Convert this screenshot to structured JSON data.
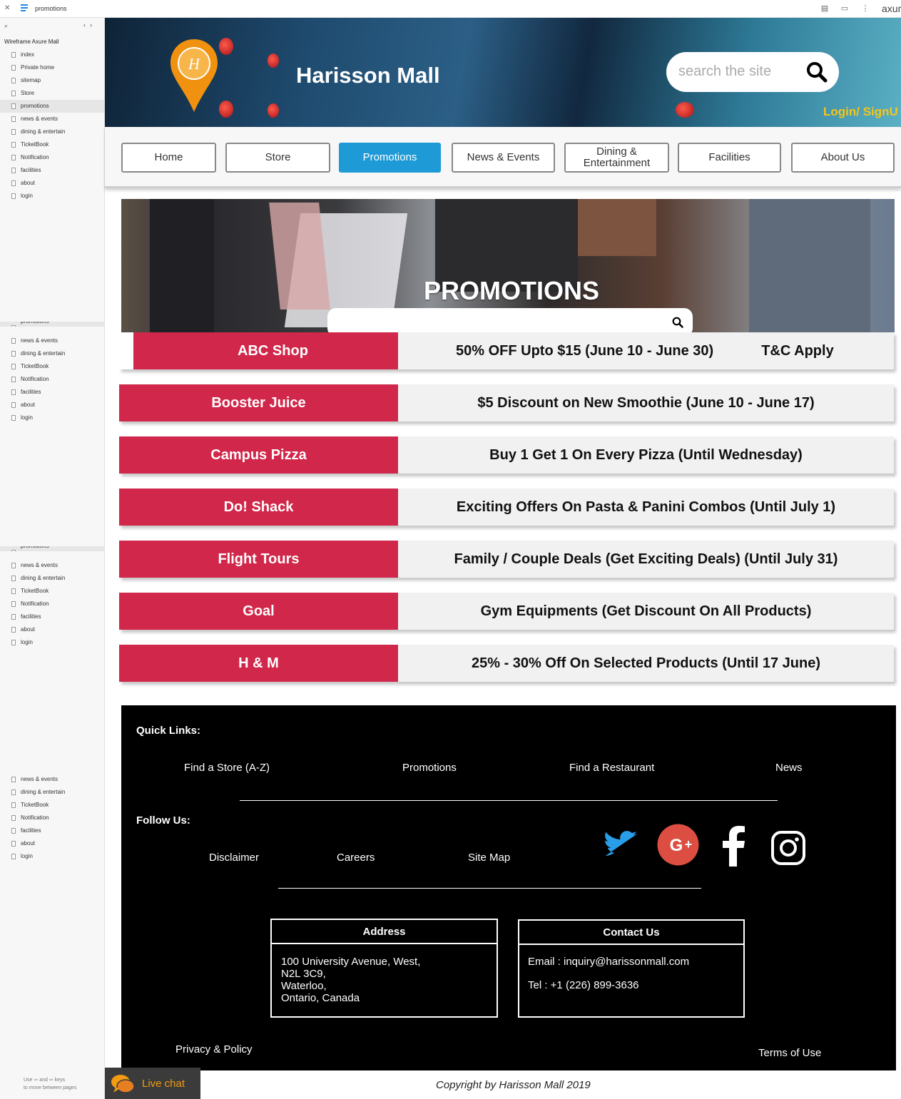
{
  "topbar": {
    "page_name": "promotions",
    "brand": "axur"
  },
  "sidebar": {
    "project": "Wireframe Axure Mall",
    "items": [
      "index",
      "Private home",
      "sitemap",
      "Store",
      "promotions",
      "news & events",
      "dining & entertain",
      "TicketBook",
      "Notification",
      "facilities",
      "about",
      "login"
    ],
    "repeat_a": [
      "promotions",
      "news & events",
      "dining & entertain",
      "TicketBook",
      "Notification",
      "facilities",
      "about",
      "login"
    ],
    "repeat_b": [
      "promotions",
      "news & events",
      "dining & entertain",
      "TicketBook",
      "Notification",
      "facilities",
      "about",
      "login"
    ],
    "repeat_c": [
      "news & events",
      "dining & entertain",
      "TicketBook",
      "Notification",
      "facilities",
      "about",
      "login"
    ],
    "hint": [
      "Use",
      "and",
      "keys",
      "to move between pages"
    ]
  },
  "header": {
    "title": "Harisson Mall",
    "search_placeholder": "search the site",
    "login": "Login/ SignU"
  },
  "nav": [
    "Home",
    "Store",
    "Promotions",
    "News & Events",
    "Dining & Entertainment",
    "Facilities",
    "About Us"
  ],
  "hero": {
    "title": "PROMOTIONS"
  },
  "promotions": [
    {
      "shop": "ABC Shop",
      "offer": "50% OFF Upto $15  (June 10 - June 30)",
      "note": "T&C Apply"
    },
    {
      "shop": "Booster Juice",
      "offer": "$5 Discount on New Smoothie (June 10 - June 17)"
    },
    {
      "shop": "Campus Pizza",
      "offer": "Buy 1 Get 1 On Every Pizza (Until Wednesday)"
    },
    {
      "shop": "Do! Shack",
      "offer": "Exciting Offers On Pasta & Panini Combos (Until July 1)"
    },
    {
      "shop": "Flight Tours",
      "offer": "Family / Couple Deals (Get Exciting Deals) (Until July 31)"
    },
    {
      "shop": "Goal",
      "offer": "Gym Equipments (Get Discount On All Products)"
    },
    {
      "shop": "H & M",
      "offer": "25% - 30% Off On Selected Products (Until 17 June)"
    }
  ],
  "footer": {
    "quick_links_label": "Quick Links:",
    "quick_links": [
      "Find a Store (A-Z)",
      "Promotions",
      "Find a Restaurant",
      "News"
    ],
    "follow_label": "Follow Us:",
    "follow_links": [
      "Disclaimer",
      "Careers",
      "Site Map"
    ],
    "address": {
      "heading": "Address",
      "lines": [
        "100 University Avenue, West,",
        "N2L 3C9,",
        "Waterloo,",
        "Ontario, Canada"
      ]
    },
    "contact": {
      "heading": "Contact Us",
      "email": "Email : inquiry@harissonmall.com",
      "tel": "Tel : +1 (226) 899-3636"
    },
    "privacy": "Privacy & Policy",
    "terms": "Terms of Use",
    "social_icons": [
      "twitter-icon",
      "google-plus-icon",
      "facebook-icon",
      "instagram-icon"
    ]
  },
  "copyright": "Copyright by Harisson Mall  2019",
  "live_chat": "Live chat",
  "colors": {
    "promo_red": "#d0274a",
    "nav_active": "#1e9ad6",
    "login_yellow": "#f5c518",
    "chat_orange": "#f39c12"
  }
}
